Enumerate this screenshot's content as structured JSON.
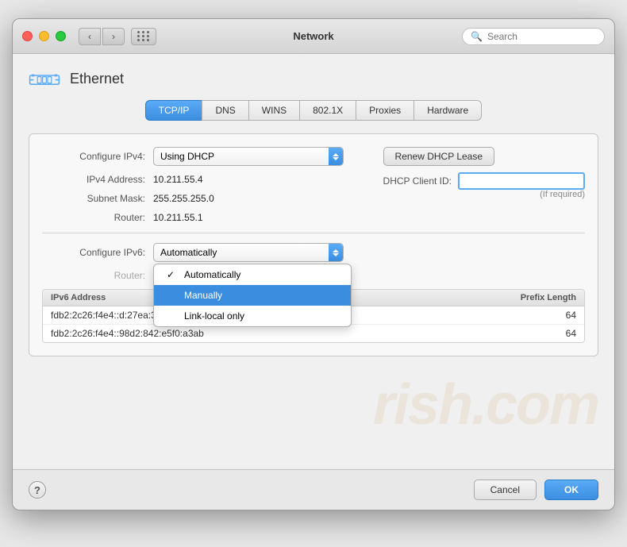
{
  "titlebar": {
    "title": "Network",
    "search_placeholder": "Search"
  },
  "tabs": [
    {
      "id": "tcpip",
      "label": "TCP/IP",
      "active": true
    },
    {
      "id": "dns",
      "label": "DNS",
      "active": false
    },
    {
      "id": "wins",
      "label": "WINS",
      "active": false
    },
    {
      "id": "8021x",
      "label": "802.1X",
      "active": false
    },
    {
      "id": "proxies",
      "label": "Proxies",
      "active": false
    },
    {
      "id": "hardware",
      "label": "Hardware",
      "active": false
    }
  ],
  "section": {
    "title": "Ethernet"
  },
  "form": {
    "configure_ipv4_label": "Configure IPv4:",
    "configure_ipv4_value": "Using DHCP",
    "ipv4_address_label": "IPv4 Address:",
    "ipv4_address_value": "10.211.55.4",
    "subnet_mask_label": "Subnet Mask:",
    "subnet_mask_value": "255.255.255.0",
    "router_label": "Router:",
    "router_value": "10.211.55.1",
    "renew_btn_label": "Renew DHCP Lease",
    "dhcp_client_id_label": "DHCP Client ID:",
    "dhcp_client_id_value": "",
    "dhcp_placeholder": "",
    "if_required": "(If required)",
    "configure_ipv6_label": "Configure IPv6:"
  },
  "dropdown": {
    "items": [
      {
        "id": "automatically",
        "label": "Automatically",
        "checked": true,
        "selected": false
      },
      {
        "id": "manually",
        "label": "Manually",
        "checked": false,
        "selected": true
      },
      {
        "id": "link-local",
        "label": "Link-local only",
        "checked": false,
        "selected": false
      }
    ]
  },
  "ipv6_table": {
    "col_address": "IPv6 Address",
    "col_prefix": "Prefix Length",
    "rows": [
      {
        "address": "fdb2:2c26:f4e4::d:27ea:3719:19d",
        "prefix": "64"
      },
      {
        "address": "fdb2:2c26:f4e4::98d2:842:e5f0:a3ab",
        "prefix": "64"
      }
    ]
  },
  "router_ipv6_label": "Router:",
  "bottom": {
    "help_label": "?",
    "cancel_label": "Cancel",
    "ok_label": "OK"
  }
}
